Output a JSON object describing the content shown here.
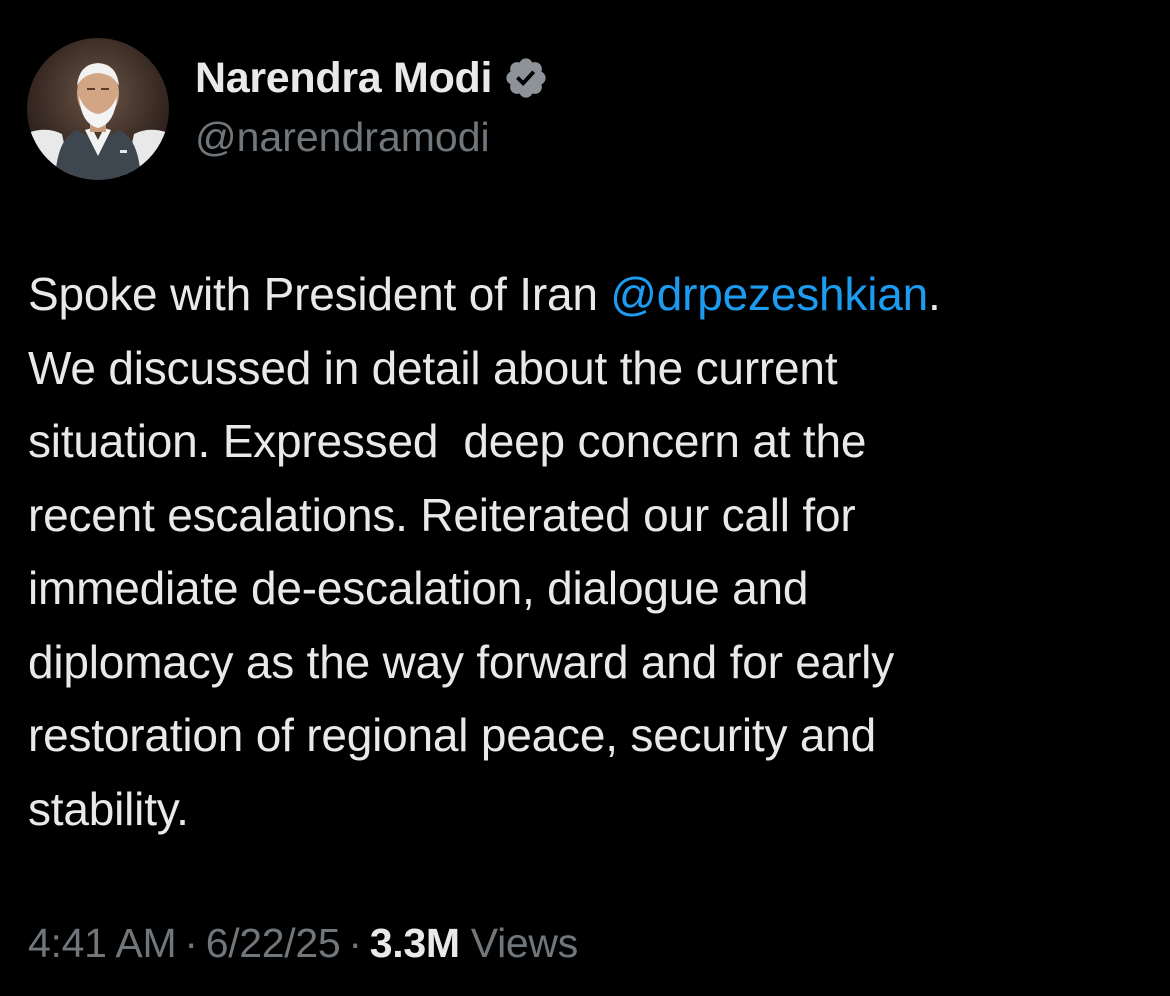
{
  "author": {
    "display_name": "Narendra Modi",
    "handle": "@narendramodi",
    "verified": true,
    "verified_badge_color": "#8e9399"
  },
  "tweet": {
    "lines": [
      {
        "before": "Spoke with President of Iran ",
        "mention": "@drpezeshkian",
        "after": "."
      },
      {
        "text": "We discussed in detail about the current"
      },
      {
        "text": "situation. Expressed  deep concern at the"
      },
      {
        "text": "recent escalations. Reiterated our call for"
      },
      {
        "text": "immediate de-escalation, dialogue and"
      },
      {
        "text": "diplomacy as the way forward and for early"
      },
      {
        "text": "restoration of regional peace, security and"
      },
      {
        "text": "stability."
      }
    ]
  },
  "meta": {
    "time": "4:41 AM",
    "separator": "·",
    "date": "6/22/25",
    "views_count": "3.3M",
    "views_label": "Views"
  },
  "colors": {
    "background": "#000000",
    "text_primary": "#e7e9ea",
    "text_secondary": "#71767b",
    "link": "#1d9bf0"
  },
  "icons": {
    "verified": "verified-badge-icon",
    "avatar": "profile-photo"
  }
}
